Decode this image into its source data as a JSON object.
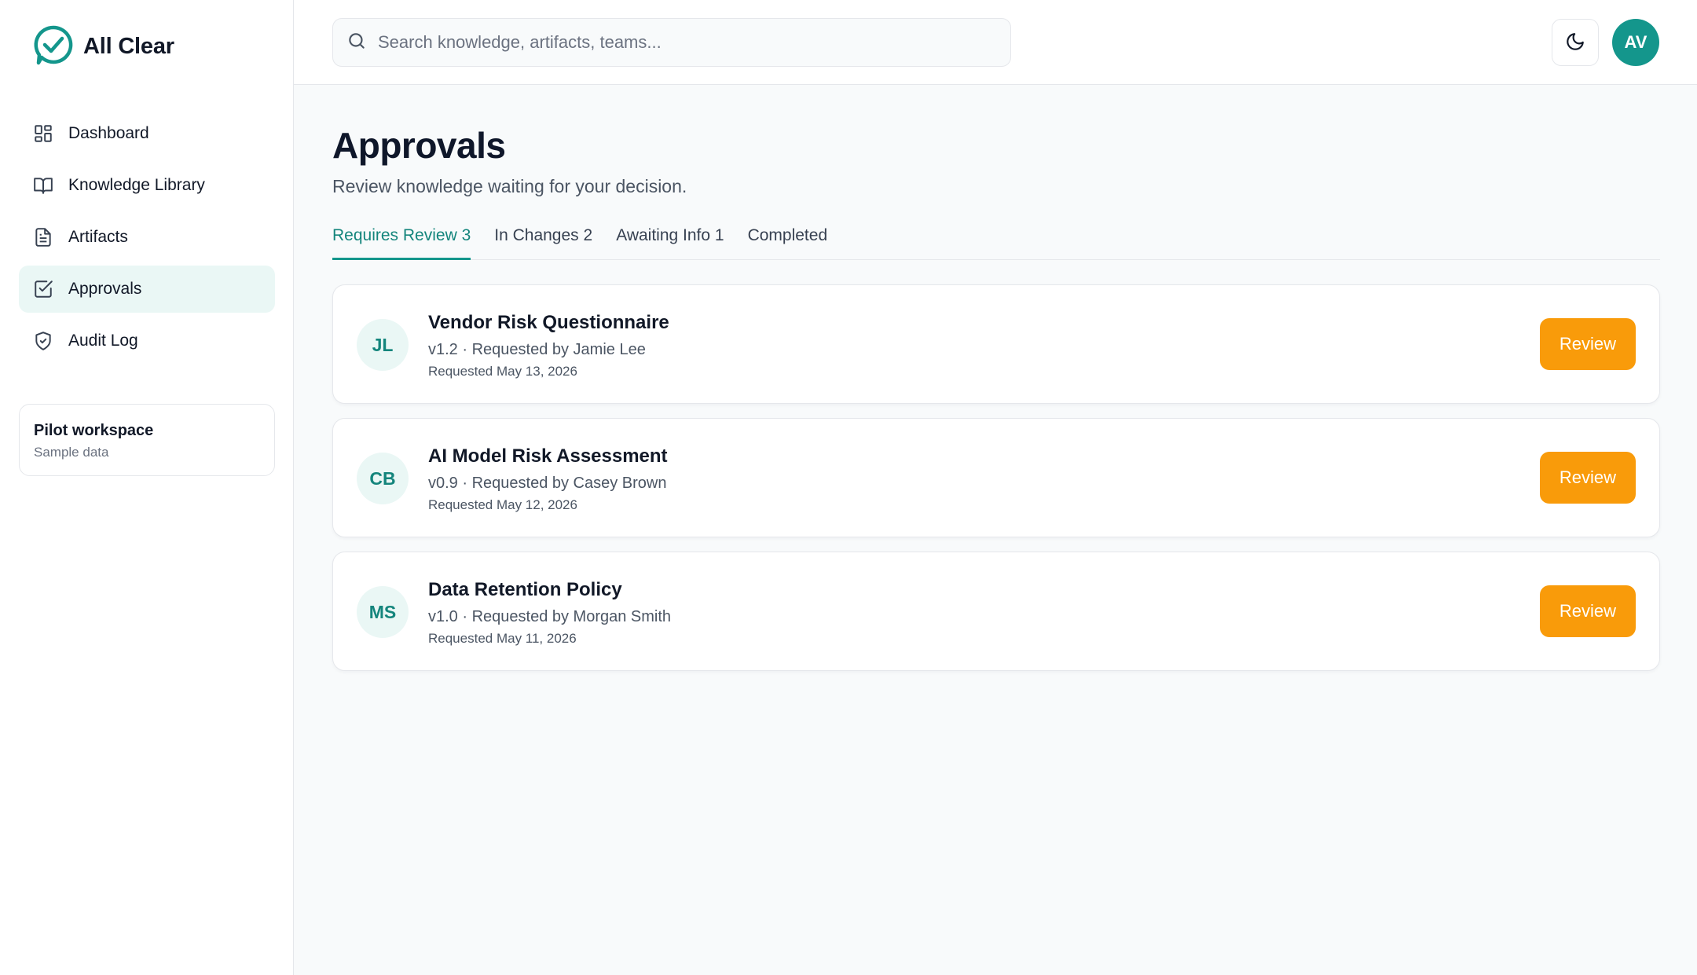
{
  "app": {
    "name": "All Clear"
  },
  "sidebar": {
    "items": [
      {
        "label": "Dashboard",
        "icon": "dashboard-icon",
        "active": false
      },
      {
        "label": "Knowledge Library",
        "icon": "book-icon",
        "active": false
      },
      {
        "label": "Artifacts",
        "icon": "document-icon",
        "active": false
      },
      {
        "label": "Approvals",
        "icon": "check-square-icon",
        "active": true
      },
      {
        "label": "Audit Log",
        "icon": "shield-icon",
        "active": false
      }
    ],
    "workspace": {
      "title": "Pilot workspace",
      "subtitle": "Sample data"
    }
  },
  "header": {
    "search_placeholder": "Search knowledge, artifacts, teams...",
    "user_initials": "AV"
  },
  "page": {
    "title": "Approvals",
    "subtitle": "Review knowledge waiting for your decision."
  },
  "tabs": [
    {
      "label": "Requires Review 3",
      "active": true
    },
    {
      "label": "In Changes 2",
      "active": false
    },
    {
      "label": "Awaiting Info 1",
      "active": false
    },
    {
      "label": "Completed",
      "active": false
    }
  ],
  "approvals": [
    {
      "initials": "JL",
      "title": "Vendor Risk Questionnaire",
      "meta": "v1.2 · Requested by Jamie Lee",
      "date": "Requested May 13, 2026",
      "action": "Review"
    },
    {
      "initials": "CB",
      "title": "AI Model Risk Assessment",
      "meta": "v0.9 · Requested by Casey Brown",
      "date": "Requested May 12, 2026",
      "action": "Review"
    },
    {
      "initials": "MS",
      "title": "Data Retention Policy",
      "meta": "v1.0 · Requested by Morgan Smith",
      "date": "Requested May 11, 2026",
      "action": "Review"
    }
  ],
  "colors": {
    "accent": "#14968c",
    "review_button": "#f99b0a",
    "active_nav_bg": "#eaf7f5"
  }
}
